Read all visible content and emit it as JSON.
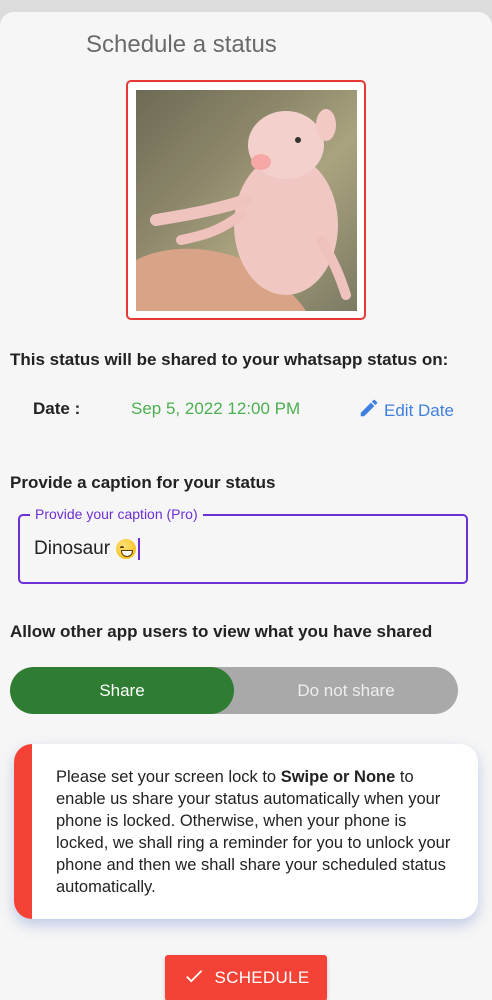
{
  "page": {
    "title": "Schedule a status"
  },
  "preview": {
    "image_alt": "status image"
  },
  "share_info": {
    "heading": "This status will be shared to your whatsapp status on:",
    "date_label": "Date :",
    "date_value": "Sep 5, 2022 12:00 PM",
    "edit_label": "Edit Date"
  },
  "caption": {
    "heading": "Provide a caption for your status",
    "floating_label": "Provide your caption (Pro)",
    "value": "Dinosaur"
  },
  "visibility": {
    "heading": "Allow other app users to view what you have shared",
    "options": [
      "Share",
      "Do not share"
    ],
    "selected": "Share"
  },
  "notice": {
    "text_before": "Please set your screen lock to ",
    "text_bold": "Swipe or None",
    "text_after": " to enable us share your status automatically when your phone is locked. Otherwise, when your phone is locked, we shall ring a reminder for you to unlock your phone and then we shall share your scheduled status automatically."
  },
  "actions": {
    "schedule_label": "SCHEDULE"
  },
  "colors": {
    "accent_red": "#f44336",
    "date_green": "#4caf50",
    "link_blue": "#3f7fe0",
    "field_purple": "#6c2fd6",
    "share_green": "#2e7d32"
  },
  "icons": {
    "edit": "pencil-icon",
    "schedule": "check-icon"
  }
}
